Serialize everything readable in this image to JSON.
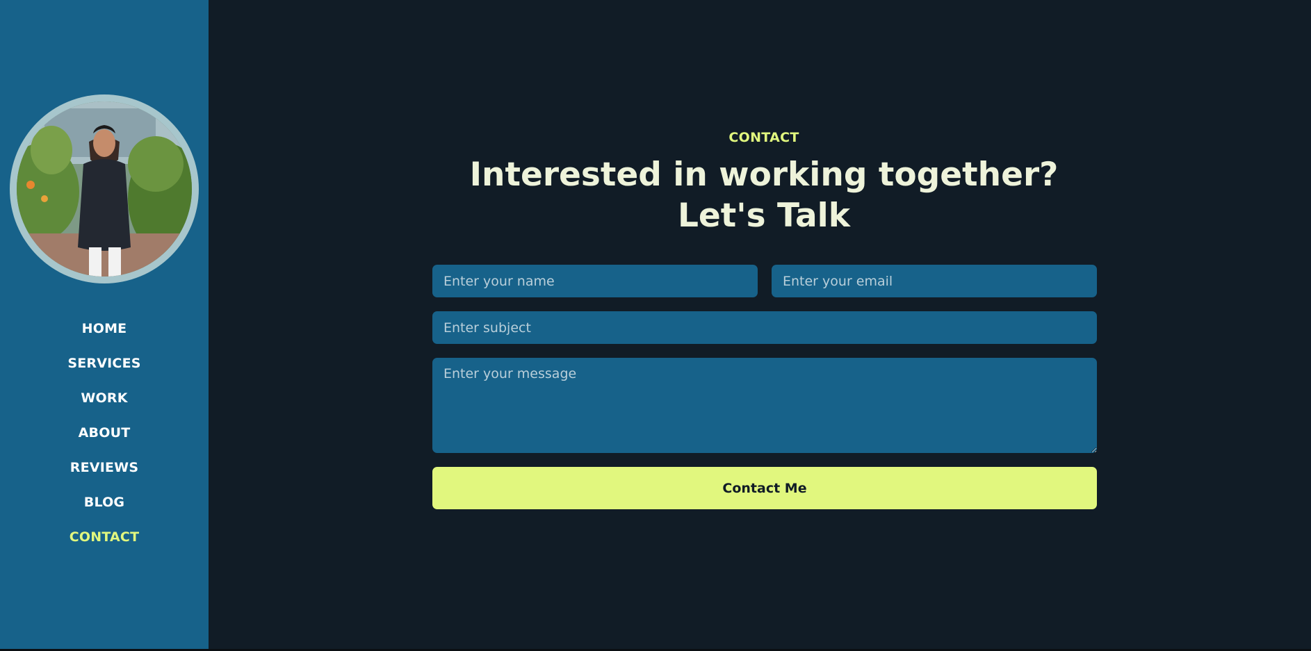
{
  "sidebar": {
    "avatar_alt": "Profile photo",
    "nav": [
      {
        "label": "HOME",
        "active": false
      },
      {
        "label": "SERVICES",
        "active": false
      },
      {
        "label": "WORK",
        "active": false
      },
      {
        "label": "ABOUT",
        "active": false
      },
      {
        "label": "REVIEWS",
        "active": false
      },
      {
        "label": "BLOG",
        "active": false
      },
      {
        "label": "CONTACT",
        "active": true
      }
    ]
  },
  "contact": {
    "section_label": "CONTACT",
    "headline_line1": "Interested in working together?",
    "headline_line2": "Let's Talk",
    "form": {
      "name_placeholder": "Enter your name",
      "email_placeholder": "Enter your email",
      "subject_placeholder": "Enter subject",
      "message_placeholder": "Enter your message",
      "submit_label": "Contact Me"
    }
  },
  "colors": {
    "sidebar_bg": "#17628a",
    "page_bg": "#111c26",
    "accent": "#e1f77e",
    "heading": "#eef3da",
    "field_bg": "#17628a"
  }
}
